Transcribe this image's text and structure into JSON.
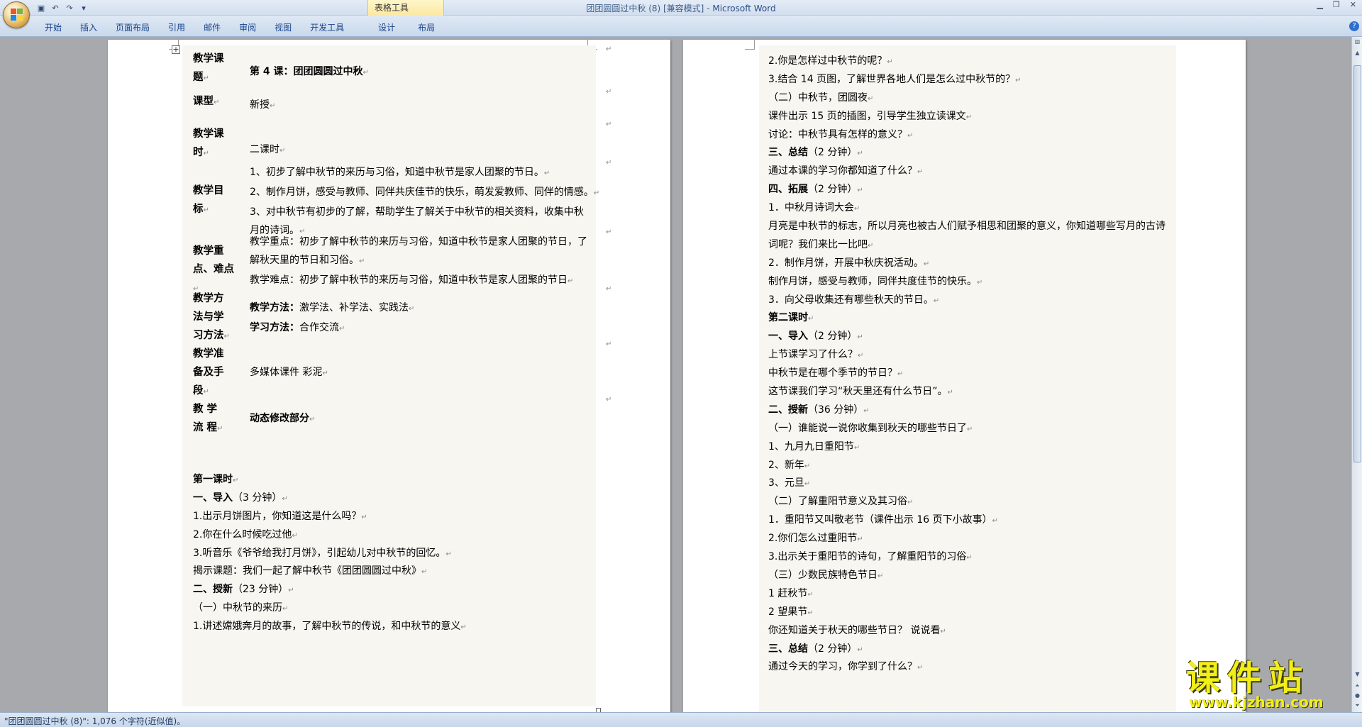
{
  "window": {
    "title_doc": "团团圆圆过中秋 (8) [兼容模式]",
    "title_sep": " - ",
    "title_app": "Microsoft Word",
    "contextual_group": "表格工具"
  },
  "quick_access": {
    "save_icon": "save-icon",
    "undo_icon": "undo-icon",
    "redo_icon": "redo-icon"
  },
  "ribbon": {
    "tabs": [
      {
        "label": "开始"
      },
      {
        "label": "插入"
      },
      {
        "label": "页面布局"
      },
      {
        "label": "引用"
      },
      {
        "label": "邮件"
      },
      {
        "label": "审阅"
      },
      {
        "label": "视图"
      },
      {
        "label": "开发工具"
      },
      {
        "label": "设计"
      },
      {
        "label": "布局"
      }
    ],
    "help": "?"
  },
  "left_page": {
    "table": [
      {
        "label_lines": [
          "教学课",
          "题"
        ],
        "content": [
          "第 4 课：团团圆圆过中秋"
        ],
        "bold": true
      },
      {
        "label_lines": [
          "课型"
        ],
        "content": [
          "新授"
        ],
        "bold": false
      },
      {
        "label_lines": [
          "教学课",
          "时"
        ],
        "content": [
          "二课时"
        ],
        "bold": false
      },
      {
        "label_lines": [
          "教学目",
          "标"
        ],
        "content": [
          "1、初步了解中秋节的来历与习俗，知道中秋节是家人团聚的节日。",
          "2、制作月饼，感受与教师、同伴共庆佳节的快乐，萌发爱教师、同伴的情感。",
          "3、对中秋节有初步的了解，帮助学生了解关于中秋节的相关资料，收集中秋",
          "月的诗词。"
        ],
        "bold": false
      },
      {
        "label_lines": [
          "教学重",
          "点、难点"
        ],
        "content": [
          "教学重点：初步了解中秋节的来历与习俗，知道中秋节是家人团聚的节日，了",
          "解秋天里的节日和习俗。",
          "教学难点：初步了解中秋节的来历与习俗，知道中秋节是家人团聚的节日"
        ],
        "bold": false
      },
      {
        "label_lines": [
          "教学方",
          "法与学",
          "习方法"
        ],
        "content_pairs": [
          {
            "k": "教学方法：",
            "v": "激学法、补学法、实践法"
          },
          {
            "k": "学习方法：",
            "v": "合作交流"
          }
        ]
      },
      {
        "label_lines": [
          "教学准",
          "备及手",
          "段"
        ],
        "content": [
          "多媒体课件 彩泥"
        ],
        "bold": false
      },
      {
        "label_lines": [
          "教 学",
          "流 程"
        ],
        "content": [
          "动态修改部分"
        ],
        "bold": true
      }
    ],
    "body_lines": [
      {
        "t": "第一课时",
        "b": true
      },
      {
        "t": "一、导入（3 分钟）",
        "b": false,
        "bp": "一、导入"
      },
      {
        "t": "1.出示月饼图片，你知道这是什么吗？",
        "b": false
      },
      {
        "t": "2.你在什么时候吃过他",
        "b": false
      },
      {
        "t": "3.听音乐《爷爷给我打月饼》，引起幼儿对中秋节的回忆。",
        "b": false
      },
      {
        "t": "揭示课题：我们一起了解中秋节《团团圆圆过中秋》",
        "b": false
      },
      {
        "t": "二、授新（23 分钟）",
        "b": false,
        "bp": "二、授新"
      },
      {
        "t": "（一）中秋节的来历",
        "b": false
      },
      {
        "t": "1.讲述嫦娥奔月的故事，了解中秋节的传说，和中秋节的意义",
        "b": false
      }
    ]
  },
  "right_page": {
    "body_lines": [
      {
        "t": "2.你是怎样过中秋节的呢？",
        "b": false
      },
      {
        "t": "3.结合 14 页图，了解世界各地人们是怎么过中秋节的？",
        "b": false
      },
      {
        "t": "（二）中秋节，团圆夜",
        "b": false
      },
      {
        "t": "课件出示 15 页的插图，引导学生独立读课文",
        "b": false
      },
      {
        "t": "讨论：中秋节具有怎样的意义？",
        "b": false
      },
      {
        "t": "三、总结（2 分钟）",
        "b": false,
        "bp": "三、总结"
      },
      {
        "t": "通过本课的学习你都知道了什么？",
        "b": false
      },
      {
        "t": "四、拓展（2 分钟）",
        "b": false,
        "bp": "四、拓展"
      },
      {
        "t": "1．中秋月诗词大会",
        "b": false
      },
      {
        "t": "月亮是中秋节的标志，所以月亮也被古人们赋予相思和团聚的意义，你知道哪些写月的古诗",
        "b": false,
        "cont": "词呢？我们来比一比吧"
      },
      {
        "t": "2．制作月饼，开展中秋庆祝活动。",
        "b": false
      },
      {
        "t": "制作月饼，感受与教师，同伴共度佳节的快乐。",
        "b": false
      },
      {
        "t": "3．向父母收集还有哪些秋天的节日。",
        "b": false
      },
      {
        "t": "第二课时",
        "b": true
      },
      {
        "t": "一、导入（2 分钟）",
        "b": false,
        "bp": "一、导入"
      },
      {
        "t": "上节课学习了什么？",
        "b": false
      },
      {
        "t": "中秋节是在哪个季节的节日？",
        "b": false
      },
      {
        "t": "这节课我们学习“秋天里还有什么节日”。",
        "b": false
      },
      {
        "t": "二、授新（36 分钟）",
        "b": false,
        "bp": "二、授新"
      },
      {
        "t": "（一）谁能说一说你收集到秋天的哪些节日了",
        "b": false
      },
      {
        "t": "1、九月九日重阳节",
        "b": false
      },
      {
        "t": "2、新年",
        "b": false
      },
      {
        "t": "3、元旦",
        "b": false
      },
      {
        "t": "（二）了解重阳节意义及其习俗",
        "b": false
      },
      {
        "t": "1．重阳节又叫敬老节（课件出示 16 页下小故事）",
        "b": false
      },
      {
        "t": "2.你们怎么过重阳节",
        "b": false
      },
      {
        "t": "3.出示关于重阳节的诗句，了解重阳节的习俗",
        "b": false
      },
      {
        "t": "（三）少数民族特色节日",
        "b": false
      },
      {
        "t": "1 赶秋节",
        "b": false
      },
      {
        "t": "2 望果节",
        "b": false
      },
      {
        "t": "你还知道关于秋天的哪些节日？  说说看",
        "b": false
      },
      {
        "t": "三、总结（2 分钟）",
        "b": false,
        "bp": "三、总结"
      },
      {
        "t": "通过今天的学习，你学到了什么？",
        "b": false
      }
    ]
  },
  "status": {
    "text": "\"团团圆圆过中秋 (8)\": 1,076 个字符(近似值)。"
  },
  "watermark": {
    "big": "课件站",
    "url": "www.kjzhan.com"
  },
  "marks": {
    "para": "↵"
  }
}
